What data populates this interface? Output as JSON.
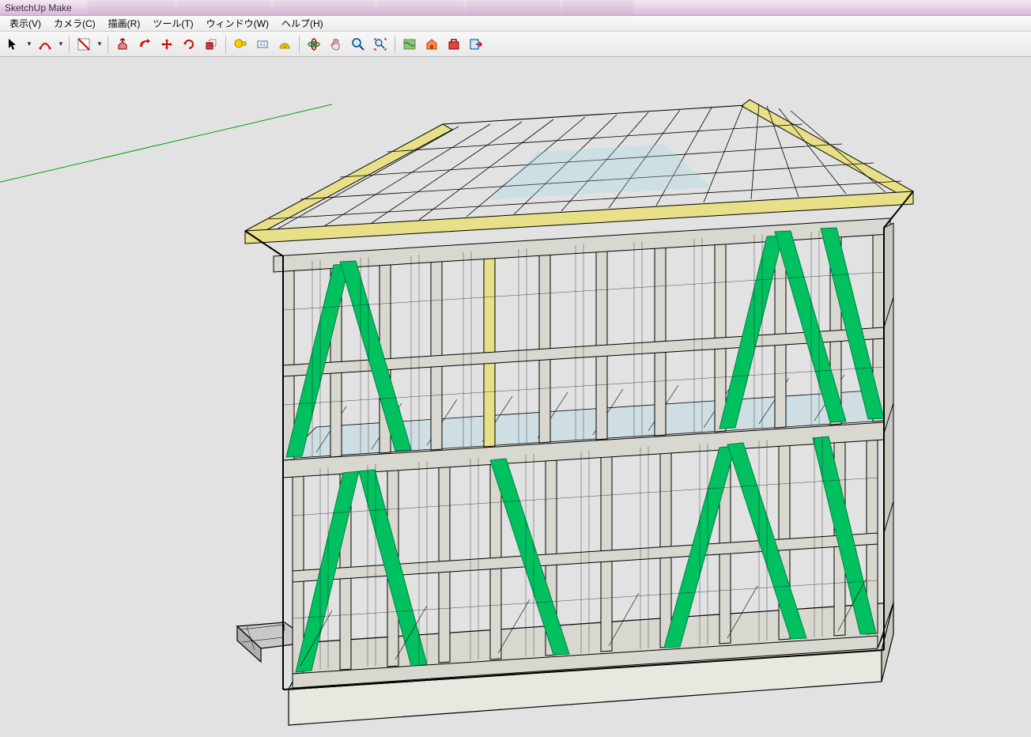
{
  "app": {
    "title": "SketchUp Make"
  },
  "menu": {
    "view": "表示(V)",
    "camera": "カメラ(C)",
    "draw": "描画(R)",
    "tools": "ツール(T)",
    "window": "ウィンドウ(W)",
    "help": "ヘルプ(H)"
  },
  "toolbar": {
    "groups": [
      [
        "select-icon",
        "arc-icon"
      ],
      [
        "face-style-icon"
      ],
      [
        "pushpull-icon",
        "followme-icon",
        "move-icon",
        "rotate-icon",
        "scale-icon"
      ],
      [
        "tape-icon",
        "dimension-icon",
        "protractor-icon"
      ],
      [
        "orbit-icon",
        "pan-icon",
        "zoom-icon",
        "zoom-extents-icon"
      ],
      [
        "map-icon",
        "warehouse-icon",
        "extensions-icon",
        "export-icon"
      ]
    ],
    "icons": {
      "select": "select-icon",
      "arc": "arc-icon",
      "face_style": "face-style-icon",
      "pushpull": "pushpull-icon",
      "followme": "followme-icon",
      "move": "move-icon",
      "rotate": "rotate-icon",
      "scale": "scale-icon",
      "tape": "tape-icon",
      "dimension": "dimension-icon",
      "protractor": "protractor-icon",
      "orbit": "orbit-icon",
      "pan": "pan-icon",
      "zoom": "zoom-icon",
      "zoom_extents": "zoom-extents-icon",
      "map": "map-icon",
      "warehouse": "warehouse-icon",
      "extensions": "extensions-icon",
      "export": "export-icon"
    }
  },
  "model": {
    "description": "Two-story timber frame house structure with hip roof, diagonal green bracing, horizontal green axis line visible in background",
    "colors": {
      "background": "#e2e2e2",
      "lumber_light": "#d8d8d0",
      "lumber_yellow": "#e8e088",
      "brace_green": "#00c060",
      "floor_cyan": "#a0d8e8",
      "axis_green": "#00a000",
      "edge": "#000000"
    }
  }
}
